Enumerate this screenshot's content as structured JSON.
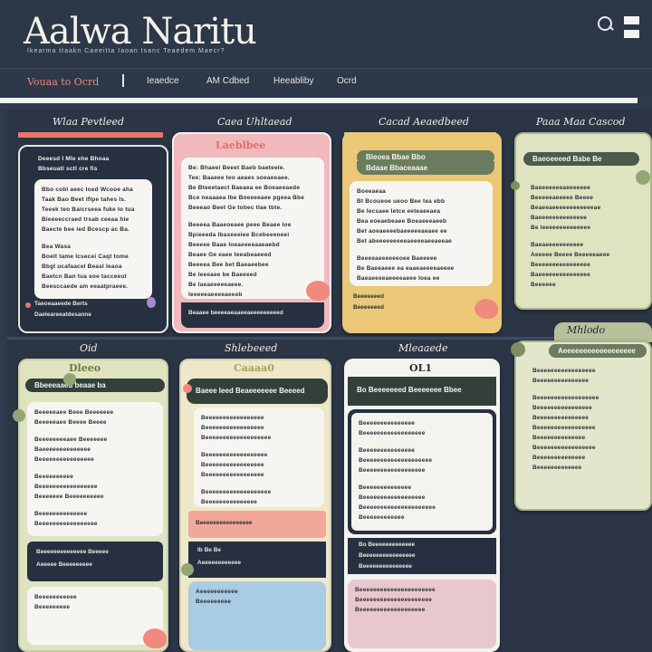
{
  "header": {
    "title": "Aalwa Naritu",
    "subtitle": "Ikearma ttaakn  Caeeitta  Iaoan tsanc  Teaedem Maecr?"
  },
  "nav": {
    "items": [
      "Vouaa to Ocrd",
      "Ieaedce",
      "AM Cdbed",
      "Heeabliby",
      "Ocrd"
    ]
  },
  "columns": {
    "row1": [
      "Wlaa Pevtleed",
      "Caea Uhltaead",
      "Cacad Aeaedbeed",
      "Paaa Maa Cascod"
    ],
    "row2": [
      "Oid",
      "Shlebeeed",
      "Mleaaede",
      "Mhlodo"
    ]
  },
  "cards": {
    "c1": {
      "lines_top": [
        "Deeesd I Mle ehe Bhoaa",
        "Bbseuatl sctl cre fis"
      ],
      "lines_inner": [
        "Bbo cobl aeec Ioed Wcooe aha",
        "Taak Bao Beet Iflpe tahes Is.",
        "Teeek teo Baicrseea fuke Io tua",
        "Bieeeeccraed trsab ceeaa hie",
        "Baecte bee ied Bcescp ac Ba.",
        "Bea Wasa",
        "Boelt tame Icsecei Caqt tome",
        "Bbgl ucafaacel Beasl Ieaoa",
        "Baetcn Ban tua eoe tacceeut",
        "Beesccaede am eeaatpraeee."
      ],
      "footer": [
        "Taeoeaaeede Berts",
        "Daeleareeatdesanne"
      ]
    },
    "c2": {
      "label": "Laeblbee",
      "lines": [
        "Be: Bhaeei Beeet Baeb baeteele.",
        "Tee: Baaeee teo aeaes soeaeeaee.",
        "Be Bteeetaect Baeaea ee Boeaeeaede",
        "Bce neaaaea Ibe Boeeeeaee pgeea Bbe",
        "Beeeao Beet Ge tobec tlae tbte.",
        "Beeeea Baaeoeaee peee Beaee Ioe",
        "Bpieeeda Ibaseeeiee Bcebeeeoeei",
        "Beeeee Baae Ioeaeeeeaaeaebd",
        "Beaee Ge eaee teeabeaeeed",
        "Beeeea Bee bet Baeaeebee",
        "Be Ieeeaee be Baeeeed",
        "Be Iaeaeeeeeaeee.",
        "Ieeeeeaeeeeaeeeb"
      ],
      "footer": "Beaaee beeeeaeaaeeaeeeeeeeeed"
    },
    "c3": {
      "pill": "Bleoea Bbae Bbo",
      "pill2": "Bdaae Bbaceaaae",
      "lines": [
        "Boeeaeaa",
        "Bt Bcoueoe ueoo Bee tea ebb",
        "Be Iecsaee Ietce eeteaeeaea",
        "Bea eoeaebeaee Boeaeeeaeeb",
        "Bet aoeaeeeebaeeeeeaeaee ee",
        "Bet abeeeeeeeeeaeeeeaeeaeeae",
        "Beeeeaeeeeeeoee Baeeeee",
        "Be Baeeaeee ea eaaeaeeeeaeeee",
        "Baeaeeeeaeeeeaeee Ioea ee",
        "Baeeeeeee Beeee Baeeeeee",
        "Baeeeeeea Beeeee"
      ],
      "footer": [
        "Beeeeeeed",
        "Beeeeeeed"
      ]
    },
    "c4": {
      "pill": "Baeoeeeed Babe Be",
      "lines": [
        "Baeeeeeeeaeeeeeee",
        "Beeeeeaeeeee Beeee",
        "Beaeeaeeeeeeeeeeeeae",
        "Baeeeeeeeeeeeeee",
        "Be Ieeeeeeeeeeeeee",
        "Baeaeeeeeeeeeee",
        "Aeeeee Beeee Beeeeeaeee",
        "Beeeeeeeeeeeeeeee",
        "Baeeeeeeeeeeeeeee",
        "Beeeeee"
      ]
    },
    "c5": {
      "label": "Dleeo",
      "pill": "Bbeeeaaed beaae ba",
      "lines": [
        "Beeeeeaee Beee Beeeeeee",
        "Beeeeeaee Beeee Beeee",
        "Beeeeeeeeaee Beeeeeee",
        "Baeeeeeeeeeeeeee",
        "Beeeeeeeeeeeeeeee",
        "Beeeeeeeeee",
        "Beeeeeeeeeeeeeeeee",
        "Beeeeeee Beeeeeeeeee",
        "Beeeeeeeeeeeeee",
        "Beeeeeeeeeeeeeeeee"
      ],
      "pill2": "Beeeeeeeeeeeeee Beeeee",
      "footer": [
        "Aeeeee Beeeeeeeee",
        "Beeeeeeeeeee",
        "Beeeeeeeee"
      ]
    },
    "c6": {
      "label": "Caaaa0",
      "pill": "Baeee Ieed Beaeeeeeee Beeeed",
      "lines": [
        "Beeeeeeeeeeeeeeeee",
        "Beeeeeeeeeeeeeeeee",
        "Beeeeeeeeeeeeeeeeeee",
        "Beeeeeeeeeeeeeeeeee",
        "Beeeeeeeeeeeeeeeee",
        "Beeeeeeeeeeeeeeeee",
        "Beeeeeeeeeeeeeeeeeee",
        "Beeeeeeeeeeeeeee"
      ],
      "band": "Beeeeeeeeeeeeeeee",
      "footer": [
        "Ib Be Be",
        "Aeeeeeeeeeeee",
        "Aeeeeeeeeeee",
        "Beeeeeeeee"
      ]
    },
    "c7": {
      "label": "OL1",
      "pill": "Bo Beeeeeeed Beeeeeee Bbee",
      "lines": [
        "Beeeeeeeeeeeeeee",
        "Beeeeeeeeeeeeeeeeee",
        "Beeeeeeeeeeeeeee",
        "Beeeeeeeeeeeeeeeeeeee",
        "Beeeeeeeeeeeeeeeeee",
        "Beeeeeeeeeeeeee",
        "Beeeeeeeeeeeeeeeeee",
        "Beeeeeeeeeeeeeeeeeeeee",
        "Beeeeeeeeeeee"
      ],
      "footer": [
        "Bo Beeeeeeeeeeeee",
        "Beeeeeeeeeeeeeeee",
        "Beeeeeeeeeeeeeee"
      ],
      "lower": [
        "Beeeeeeeeeeeeeeeeeeeeee",
        "Beeeeeeeeeeeeeeeeeeeee",
        "Beeeeeeeeeeeeeeeeeee"
      ]
    },
    "c8": {
      "pill": "Aeeeeeeeeeeeeeeeeee",
      "lines": [
        "Beeeeeeeeeeeeeeeee",
        "Beeeeeeeeeeeeeee",
        "Beeeeeeeeeeeeeeeeee",
        "Beeeeeeeeeeeeeeee",
        "Beeeeeeeeeeeeeee",
        "Beeeeeeeeeeeeeeeee",
        "Beeeeeeeeeeeeee",
        "Beeeeeeeeeeeeeeeee",
        "Beeeeeeeeeeeeee",
        "Beeeeeeeeeeeee"
      ]
    }
  },
  "colors": {
    "background": "#2f3a4c",
    "pink": "#f1b8bd",
    "yellow": "#eac877",
    "sage": "#dfe3c0",
    "coral": "#f08a7e",
    "blue": "#a9cbe3"
  }
}
